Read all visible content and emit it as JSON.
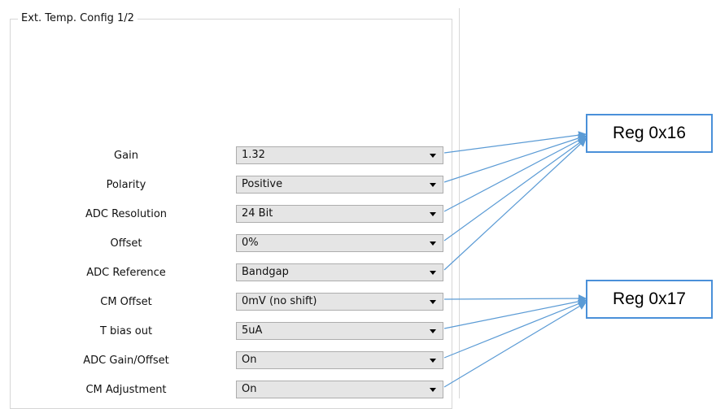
{
  "group": {
    "title": "Ext. Temp. Config 1/2"
  },
  "rows": [
    {
      "label": "Gain",
      "value": "1.32"
    },
    {
      "label": "Polarity",
      "value": "Positive"
    },
    {
      "label": "ADC Resolution",
      "value": "24 Bit"
    },
    {
      "label": "Offset",
      "value": "0%"
    },
    {
      "label": "ADC Reference",
      "value": "Bandgap"
    },
    {
      "label": "CM Offset",
      "value": "0mV (no shift)"
    },
    {
      "label": "T bias out",
      "value": "5uA"
    },
    {
      "label": "ADC Gain/Offset",
      "value": "On"
    },
    {
      "label": "CM Adjustment",
      "value": "On"
    }
  ],
  "annotations": [
    {
      "label": "Reg 0x16"
    },
    {
      "label": "Reg 0x17"
    }
  ],
  "colors": {
    "arrow": "#5b9bd5",
    "box_border": "#4a90d9",
    "combo_bg": "#e5e5e5"
  }
}
